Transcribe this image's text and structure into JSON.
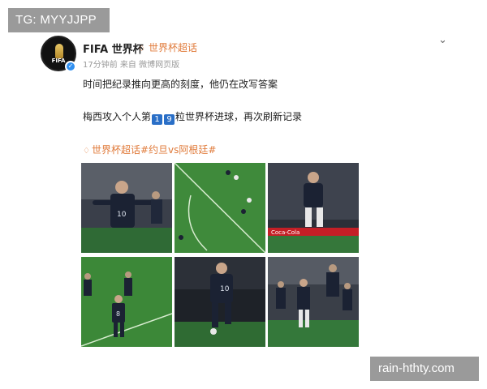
{
  "watermarks": {
    "top_left": "TG: MYYJJPP",
    "bottom_right": "rain-hthty.com"
  },
  "post": {
    "author": {
      "name": "FIFA 世界杯",
      "avatar_text": "FIFA",
      "tag": "世界杯超话"
    },
    "meta": "17分钟前 来自 微博网页版",
    "text_line1": "时间把纪录推向更高的刻度，他仍在改写答案",
    "text_line2_before": "梅西攻入个人第",
    "digit1": "1",
    "digit2": "9",
    "text_line2_after": "粒世界杯进球，再次刷新记录",
    "topic": "世界杯超话#约旦vs阿根廷#"
  },
  "icons": {
    "menu": "chevron-down-icon",
    "verified": "verified-badge-icon",
    "supertopic": "diamond-icon"
  },
  "photos": [
    {
      "name": "photo-messi-celebrating"
    },
    {
      "name": "photo-aerial-pitch"
    },
    {
      "name": "photo-goal-celebration-jump"
    },
    {
      "name": "photo-players-on-pitch"
    },
    {
      "name": "photo-messi-shooting"
    },
    {
      "name": "photo-team-celebration"
    }
  ],
  "photo_texts": {
    "p1_number": "10",
    "p4_number": "8",
    "p5_number": "10",
    "p3_banner": "Coca-Cola"
  }
}
